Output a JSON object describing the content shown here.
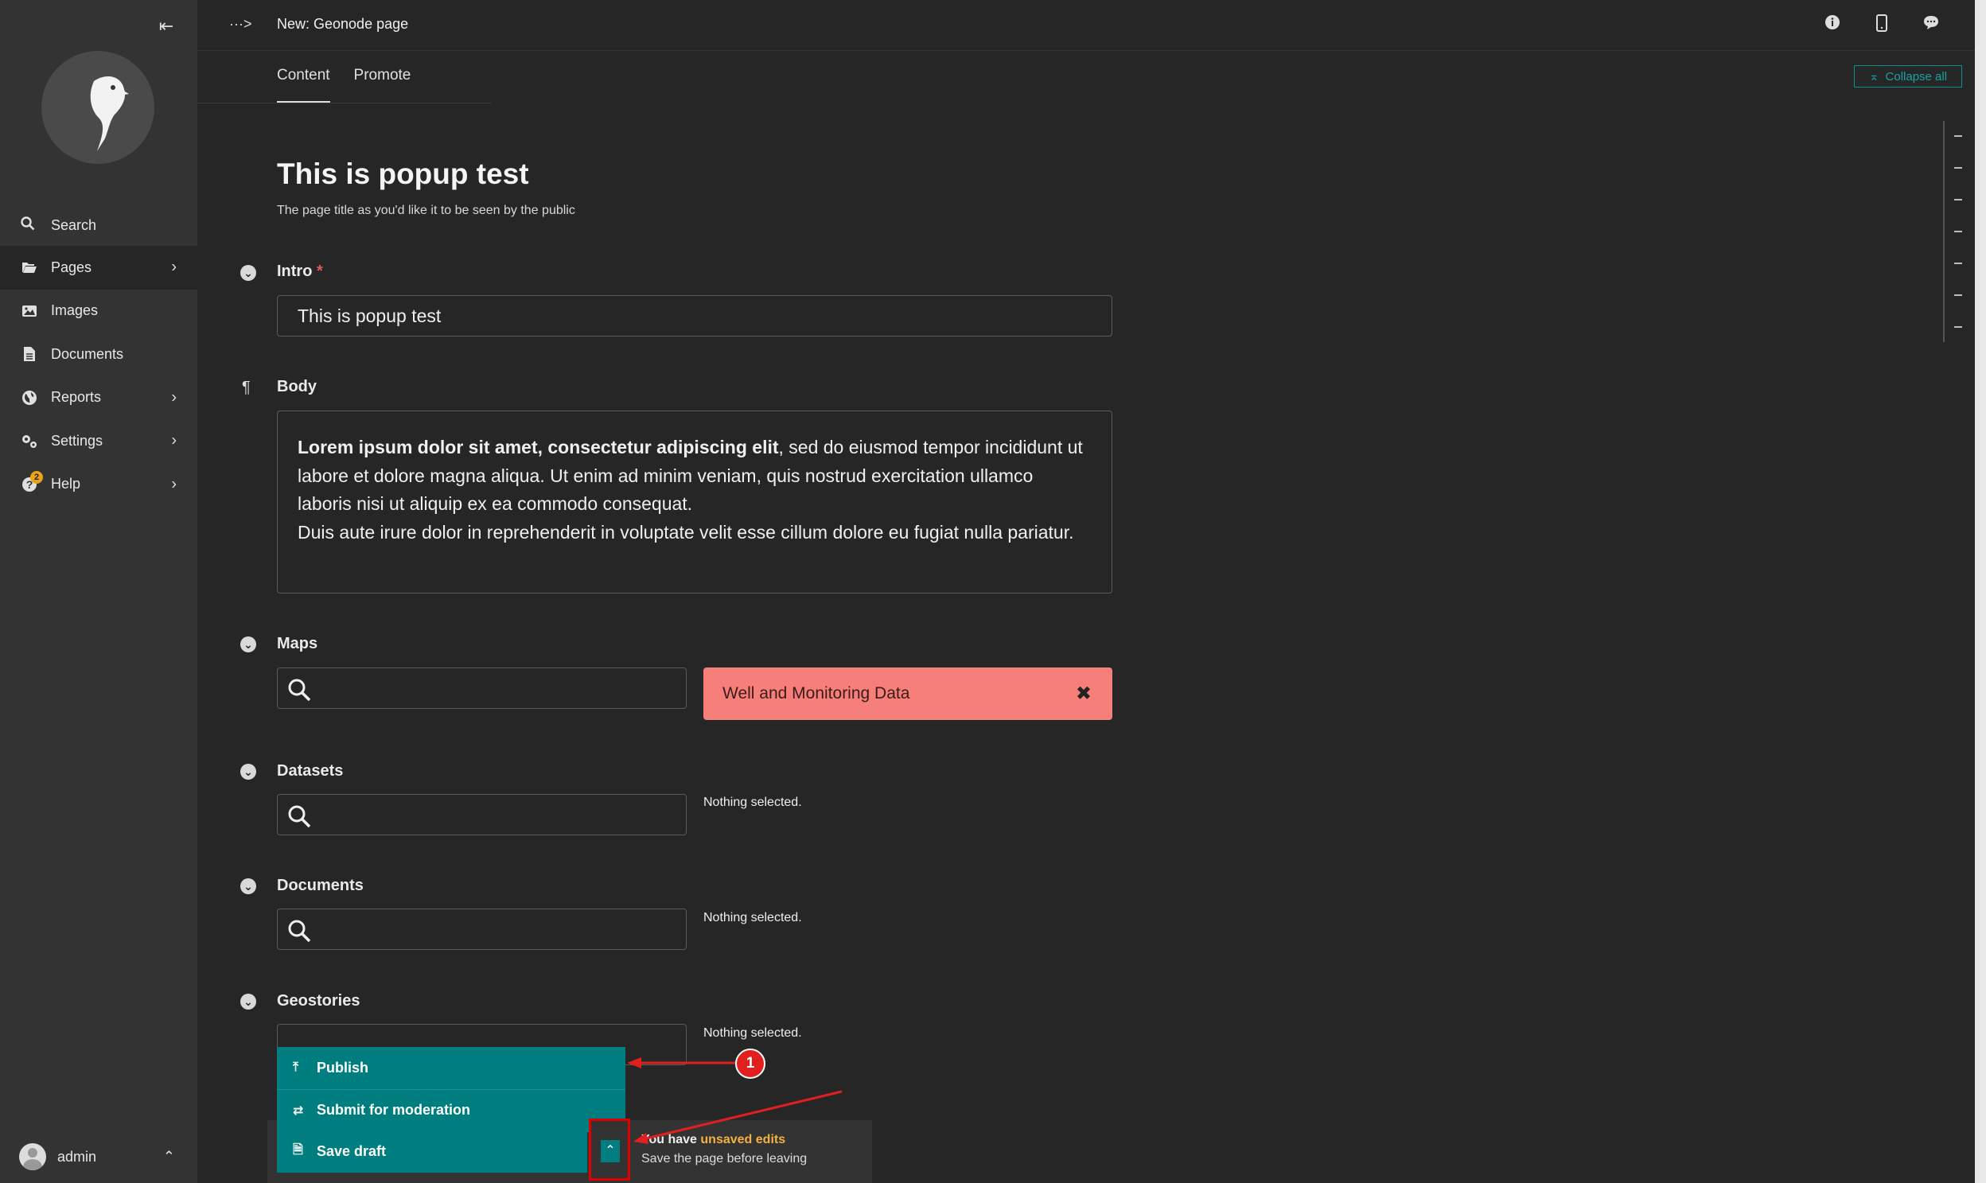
{
  "sidebar": {
    "search_label": "Search",
    "items": [
      {
        "label": "Pages",
        "icon": "folder-open-icon",
        "has_children": true
      },
      {
        "label": "Images",
        "icon": "image-icon",
        "has_children": false
      },
      {
        "label": "Documents",
        "icon": "document-icon",
        "has_children": false
      },
      {
        "label": "Reports",
        "icon": "globe-icon",
        "has_children": true
      },
      {
        "label": "Settings",
        "icon": "cogs-icon",
        "has_children": true
      },
      {
        "label": "Help",
        "icon": "help-icon",
        "has_children": true,
        "badge": "2"
      }
    ],
    "account_name": "admin"
  },
  "header": {
    "title": "New: Geonode page"
  },
  "tabs": [
    {
      "label": "Content",
      "active": true
    },
    {
      "label": "Promote",
      "active": false
    }
  ],
  "collapse_all_label": "Collapse all",
  "page": {
    "title_value": "This is popup test",
    "title_help": "The page title as you'd like it to be seen by the public"
  },
  "fields": {
    "intro": {
      "label": "Intro",
      "required_marker": "*",
      "value": "This is popup test"
    },
    "body": {
      "label": "Body",
      "bold_text": "Lorem ipsum dolor sit amet, consectetur adipiscing elit",
      "text_rest": ", sed do eiusmod tempor incididunt ut labore et dolore magna aliqua. Ut enim ad minim veniam, quis nostrud exercitation ullamco laboris nisi ut aliquip ex ea commodo consequat.",
      "text_line2": "Duis aute irure dolor in reprehenderit in voluptate velit esse cillum dolore eu fugiat nulla pariatur."
    },
    "maps": {
      "label": "Maps",
      "selected": "Well and Monitoring Data"
    },
    "datasets": {
      "label": "Datasets",
      "status": "Nothing selected."
    },
    "documents": {
      "label": "Documents",
      "status": "Nothing selected."
    },
    "geostories": {
      "label": "Geostories",
      "status": "Nothing selected."
    }
  },
  "actions": {
    "publish": "Publish",
    "submit": "Submit for moderation",
    "save_draft": "Save draft"
  },
  "footer": {
    "unsaved_prefix": "You have",
    "unsaved_highlight": "unsaved edits",
    "unsaved_sub": "Save the page before leaving"
  },
  "annotation": {
    "marker_number": "1",
    "color": "#e21f1f"
  }
}
